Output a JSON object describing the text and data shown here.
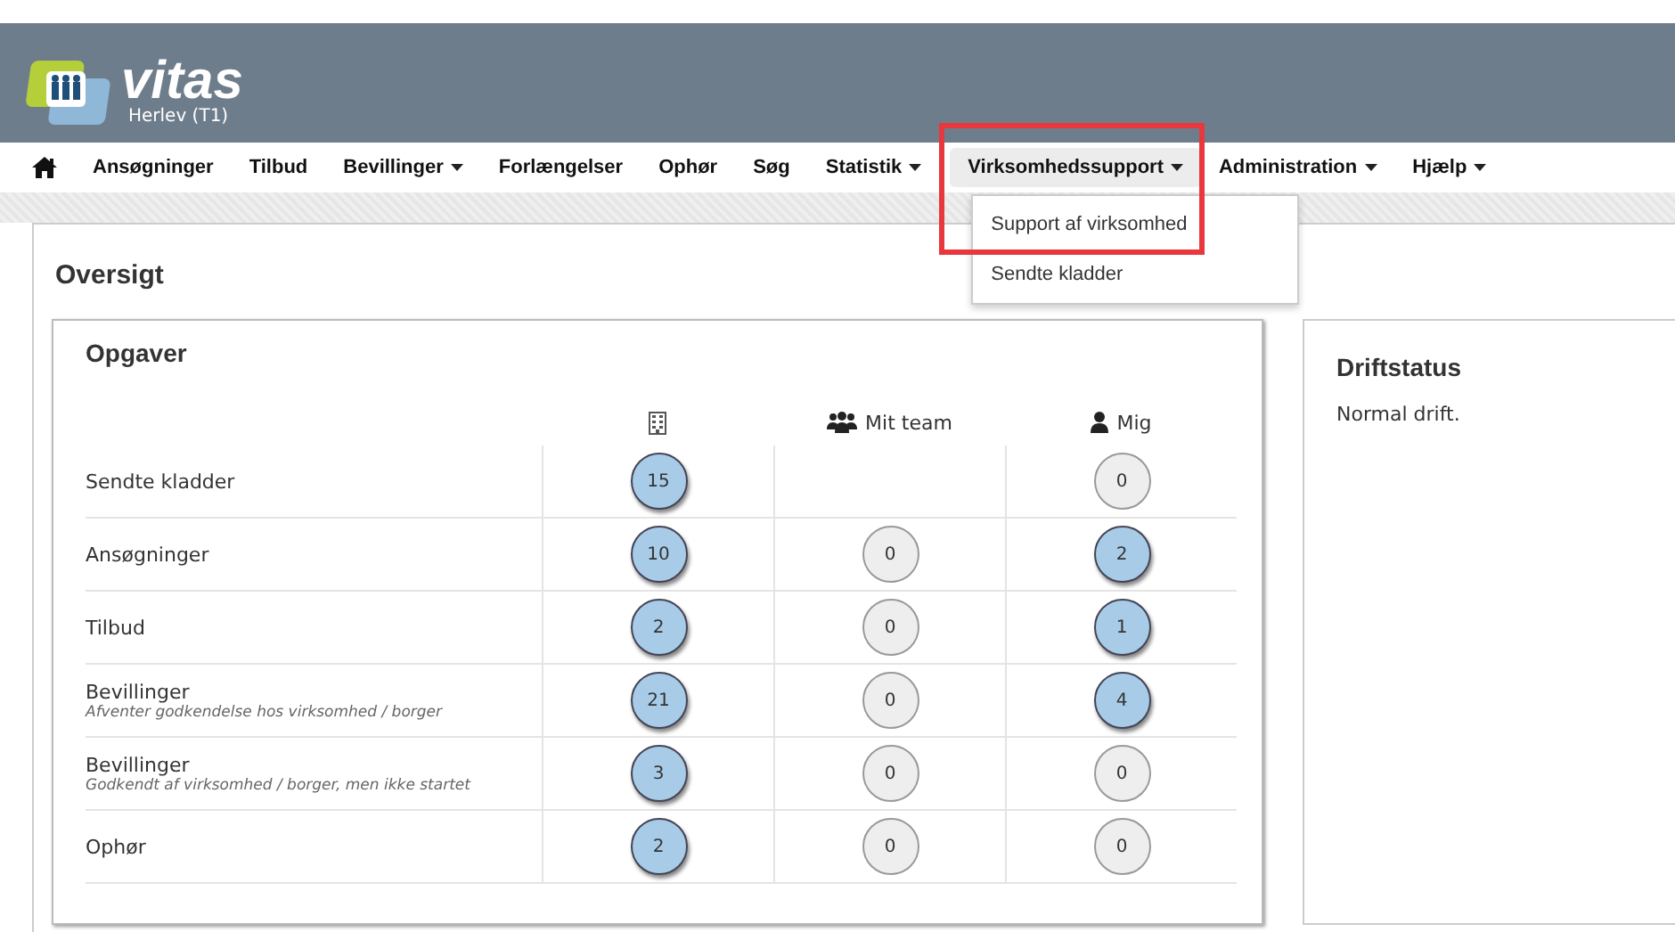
{
  "header": {
    "logo_text": "vitas",
    "location": "Herlev (T1)"
  },
  "nav": [
    {
      "label": "Ansøgninger",
      "has_menu": false,
      "open": false
    },
    {
      "label": "Tilbud",
      "has_menu": false,
      "open": false
    },
    {
      "label": "Bevillinger",
      "has_menu": true,
      "open": false
    },
    {
      "label": "Forlængelser",
      "has_menu": false,
      "open": false
    },
    {
      "label": "Ophør",
      "has_menu": false,
      "open": false
    },
    {
      "label": "Søg",
      "has_menu": false,
      "open": false
    },
    {
      "label": "Statistik",
      "has_menu": true,
      "open": false
    },
    {
      "label": "Virksomhedssupport",
      "has_menu": true,
      "open": true,
      "menu": [
        "Support af virksomhed",
        "Sendte kladder"
      ]
    },
    {
      "label": "Administration",
      "has_menu": true,
      "open": false
    },
    {
      "label": "Hjælp",
      "has_menu": true,
      "open": false
    }
  ],
  "page_title": "Oversigt",
  "tasks": {
    "title": "Opgaver",
    "columns": [
      {
        "kind": "building"
      },
      {
        "kind": "team",
        "label": "Mit team"
      },
      {
        "kind": "person",
        "label": "Mig"
      }
    ],
    "rows": [
      {
        "name": "Sendte kladder",
        "counts": {
          "building": {
            "value": "15",
            "highlighted": true
          },
          "person": {
            "value": "0",
            "highlighted": false
          }
        }
      },
      {
        "name": "Ansøgninger",
        "counts": {
          "building": {
            "value": "10",
            "highlighted": true
          },
          "team": {
            "value": "0",
            "highlighted": false
          },
          "person": {
            "value": "2",
            "highlighted": true
          }
        }
      },
      {
        "name": "Tilbud",
        "counts": {
          "building": {
            "value": "2",
            "highlighted": true
          },
          "team": {
            "value": "0",
            "highlighted": false
          },
          "person": {
            "value": "1",
            "highlighted": true
          }
        }
      },
      {
        "name": "Bevillinger",
        "note": "Afventer godkendelse hos virksomhed / borger",
        "counts": {
          "building": {
            "value": "21",
            "highlighted": true
          },
          "team": {
            "value": "0",
            "highlighted": false
          },
          "person": {
            "value": "4",
            "highlighted": true
          }
        }
      },
      {
        "name": "Bevillinger",
        "note": "Godkendt af virksomhed / borger, men ikke startet",
        "counts": {
          "building": {
            "value": "3",
            "highlighted": true
          },
          "team": {
            "value": "0",
            "highlighted": false
          },
          "person": {
            "value": "0",
            "highlighted": false
          }
        }
      },
      {
        "name": "Ophør",
        "counts": {
          "building": {
            "value": "2",
            "highlighted": true
          },
          "team": {
            "value": "0",
            "highlighted": false
          },
          "person": {
            "value": "0",
            "highlighted": false
          }
        }
      }
    ]
  },
  "status": {
    "title": "Driftstatus",
    "text": "Normal drift."
  }
}
